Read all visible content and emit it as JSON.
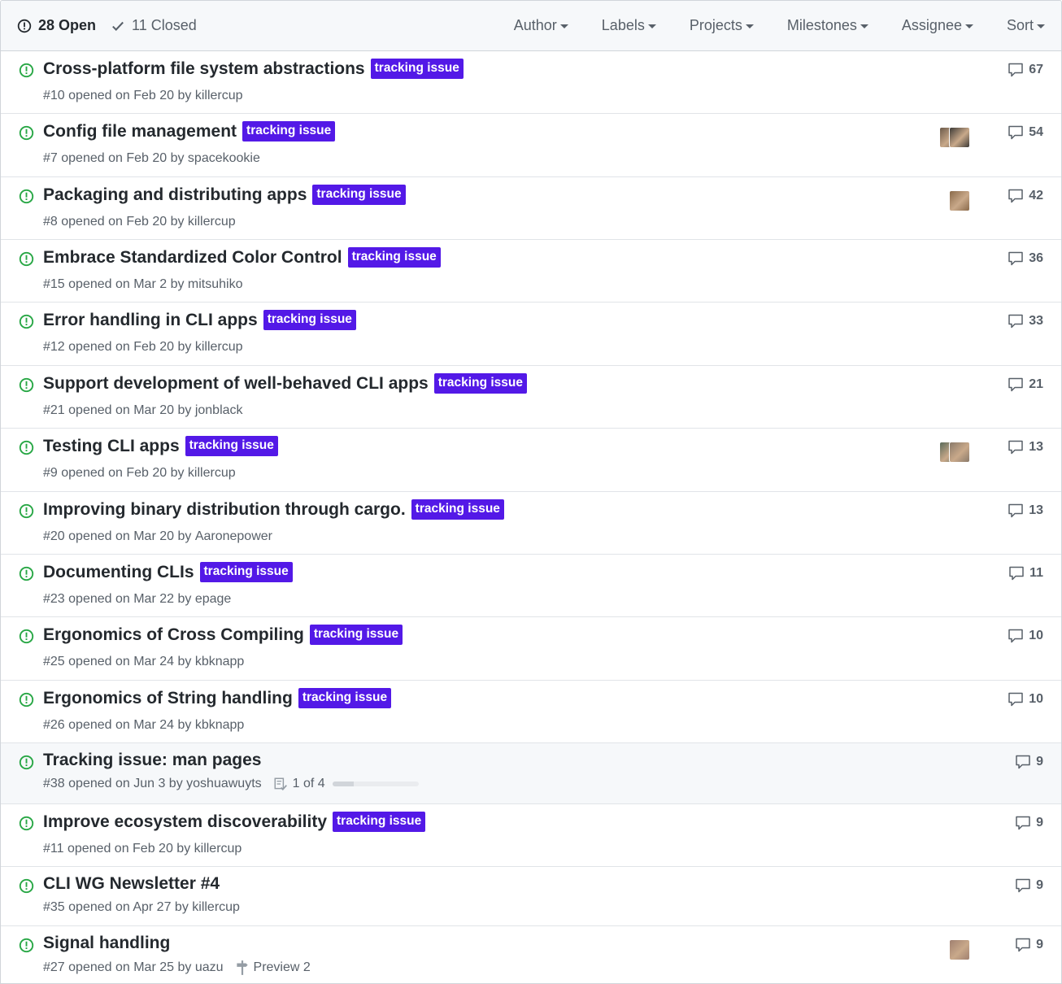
{
  "header": {
    "open_label": "28 Open",
    "closed_label": "11 Closed",
    "filters": [
      "Author",
      "Labels",
      "Projects",
      "Milestones",
      "Assignee",
      "Sort"
    ]
  },
  "colors": {
    "label_bg": "#5319e7",
    "open_icon": "#28a745"
  },
  "issues": [
    {
      "title": "Cross-platform file system abstractions",
      "label": "tracking issue",
      "meta": "#10 opened on Feb 20 by ",
      "author": "killercup",
      "comments": "67",
      "assignees": 0
    },
    {
      "title": "Config file management",
      "label": "tracking issue",
      "meta": "#7 opened on Feb 20 by ",
      "author": "spacekookie",
      "comments": "54",
      "assignees": 2
    },
    {
      "title": "Packaging and distributing apps",
      "label": "tracking issue",
      "meta": "#8 opened on Feb 20 by ",
      "author": "killercup",
      "comments": "42",
      "assignees": 1
    },
    {
      "title": "Embrace Standardized Color Control",
      "label": "tracking issue",
      "meta": "#15 opened on Mar 2 by ",
      "author": "mitsuhiko",
      "comments": "36",
      "assignees": 0
    },
    {
      "title": "Error handling in CLI apps",
      "label": "tracking issue",
      "meta": "#12 opened on Feb 20 by ",
      "author": "killercup",
      "comments": "33",
      "assignees": 0
    },
    {
      "title": "Support development of well-behaved CLI apps",
      "label": "tracking issue",
      "meta": "#21 opened on Mar 20 by ",
      "author": "jonblack",
      "comments": "21",
      "assignees": 0
    },
    {
      "title": "Testing CLI apps",
      "label": "tracking issue",
      "meta": "#9 opened on Feb 20 by ",
      "author": "killercup",
      "comments": "13",
      "assignees": 2
    },
    {
      "title": "Improving binary distribution through cargo.",
      "label": "tracking issue",
      "meta": "#20 opened on Mar 20 by ",
      "author": "Aaronepower",
      "comments": "13",
      "assignees": 0
    },
    {
      "title": "Documenting CLIs",
      "label": "tracking issue",
      "meta": "#23 opened on Mar 22 by ",
      "author": "epage",
      "comments": "11",
      "assignees": 0
    },
    {
      "title": "Ergonomics of Cross Compiling",
      "label": "tracking issue",
      "meta": "#25 opened on Mar 24 by ",
      "author": "kbknapp",
      "comments": "10",
      "assignees": 0
    },
    {
      "title": "Ergonomics of String handling",
      "label": "tracking issue",
      "meta": "#26 opened on Mar 24 by ",
      "author": "kbknapp",
      "comments": "10",
      "assignees": 0
    },
    {
      "title": "Tracking issue: man pages",
      "label": "",
      "meta": "#38 opened on Jun 3 by ",
      "author": "yoshuawuyts",
      "comments": "9",
      "assignees": 0,
      "highlight": true,
      "tasks": "1 of 4",
      "task_progress": 0.25
    },
    {
      "title": "Improve ecosystem discoverability",
      "label": "tracking issue",
      "meta": "#11 opened on Feb 20 by ",
      "author": "killercup",
      "comments": "9",
      "assignees": 0
    },
    {
      "title": "CLI WG Newsletter #4",
      "label": "",
      "meta": "#35 opened on Apr 27 by ",
      "author": "killercup",
      "comments": "9",
      "assignees": 0
    },
    {
      "title": "Signal handling",
      "label": "",
      "meta": "#27 opened on Mar 25 by ",
      "author": "uazu",
      "comments": "9",
      "assignees": 1,
      "milestone": "Preview 2"
    }
  ]
}
